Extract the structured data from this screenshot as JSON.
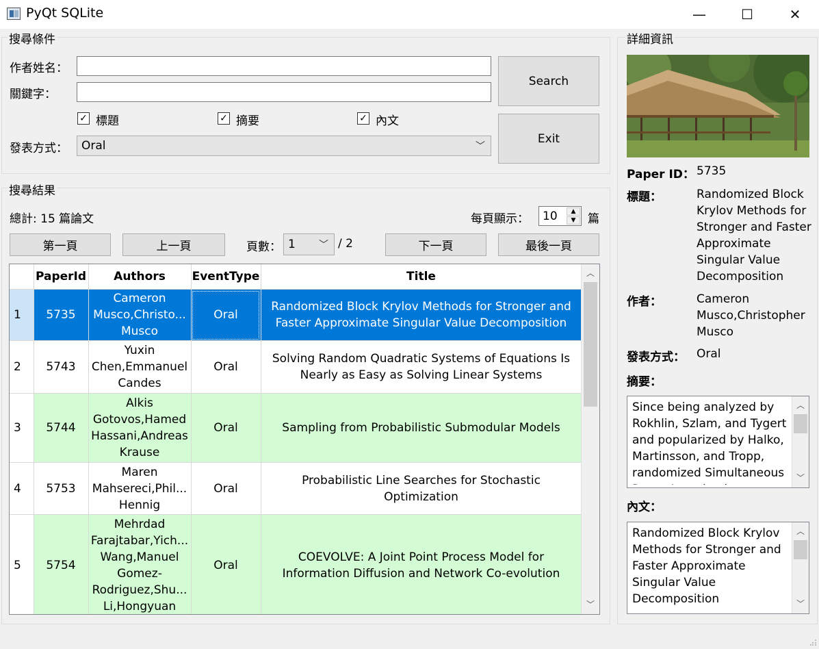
{
  "window": {
    "title": "PyQt SQLite",
    "minimize": "—",
    "maximize": "☐",
    "close": "✕"
  },
  "search": {
    "group_title": "搜尋條件",
    "author_label": "作者姓名：",
    "author_value": "",
    "keyword_label": "關鍵字：",
    "keyword_value": "",
    "check_title": "標題",
    "check_abstract": "摘要",
    "check_content": "內文",
    "event_label": "發表方式：",
    "event_value": "Oral",
    "search_button": "Search",
    "exit_button": "Exit"
  },
  "results": {
    "group_title": "搜尋結果",
    "total": "總計: 15 篇論文",
    "per_page_label": "每頁顯示：",
    "per_page_value": "10",
    "per_page_unit": "篇",
    "first_page": "第一頁",
    "prev_page": "上一頁",
    "page_label": "頁數：",
    "page_value": "1",
    "page_total": "/ 2",
    "next_page": "下一頁",
    "last_page": "最後一頁",
    "columns": [
      "PaperId",
      "Authors",
      "EventType",
      "Title"
    ],
    "rows": [
      {
        "num": "1",
        "id": "5735",
        "authors": "Cameron Musco,Christo... Musco",
        "event": "Oral",
        "title": "Randomized Block Krylov Methods for Stronger and Faster Approximate Singular Value Decomposition",
        "state": "sel"
      },
      {
        "num": "2",
        "id": "5743",
        "authors": "Yuxin Chen,Emmanuel Candes",
        "event": "Oral",
        "title": "Solving Random Quadratic Systems of Equations Is Nearly as Easy as Solving Linear Systems",
        "state": "white"
      },
      {
        "num": "3",
        "id": "5744",
        "authors": "Alkis Gotovos,Hamed Hassani,Andreas Krause",
        "event": "Oral",
        "title": "Sampling from Probabilistic Submodular Models",
        "state": "green"
      },
      {
        "num": "4",
        "id": "5753",
        "authors": "Maren Mahsereci,Phil... Hennig",
        "event": "Oral",
        "title": "Probabilistic Line Searches for Stochastic Optimization",
        "state": "white"
      },
      {
        "num": "5",
        "id": "5754",
        "authors": "Mehrdad Farajtabar,Yich... Wang,Manuel Gomez-Rodriguez,Shu... Li,Hongyuan",
        "event": "Oral",
        "title": "COEVOLVE: A Joint Point Process Model for Information Diffusion and Network Co-evolution",
        "state": "green"
      }
    ]
  },
  "detail": {
    "group_title": "詳細資訊",
    "paper_id_label": "Paper ID：",
    "paper_id_value": "5735",
    "title_label": "標題：",
    "title_value": "Randomized Block Krylov Methods for Stronger and Faster Approximate Singular Value Decomposition",
    "author_label": "作者：",
    "author_value": "Cameron Musco,Christopher Musco",
    "event_label": "發表方式：",
    "event_value": "Oral",
    "abstract_label": "摘要：",
    "abstract_text": "Since being analyzed by Rokhlin, Szlam, and Tygert and popularized by Halko, Martinsson, and Tropp, randomized Simultaneous Power Iteration has",
    "content_label": "內文：",
    "content_text": "Randomized Block Krylov Methods for Stronger and Faster Approximate Singular Value Decomposition"
  }
}
